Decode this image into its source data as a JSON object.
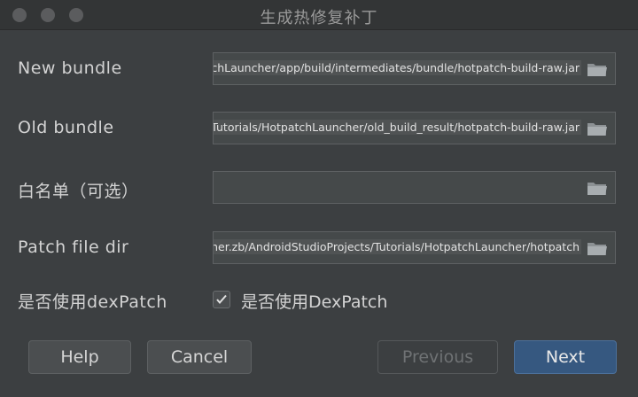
{
  "window": {
    "title": "生成热修复补丁"
  },
  "rows": [
    {
      "label": "New bundle",
      "value": ":patchLauncher/app/build/intermediates/bundle/hotpatch-build-raw.jar"
    },
    {
      "label": "Old bundle",
      "value": "ts/Tutorials/HotpatchLauncher/old_build_result/hotpatch-build-raw.jar"
    },
    {
      "label": "白名单（可选）",
      "value": ""
    },
    {
      "label": "Patch file dir",
      "value": "rcher.zb/AndroidStudioProjects/Tutorials/HotpatchLauncher/hotpatch"
    }
  ],
  "dexpatch": {
    "label": "是否使用dexPatch",
    "checkbox_label": "是否使用DexPatch",
    "checked": true
  },
  "buttons": {
    "help": "Help",
    "cancel": "Cancel",
    "previous": "Previous",
    "next": "Next"
  },
  "icons": {
    "browse": "folder-icon",
    "check": "checkmark-icon"
  }
}
